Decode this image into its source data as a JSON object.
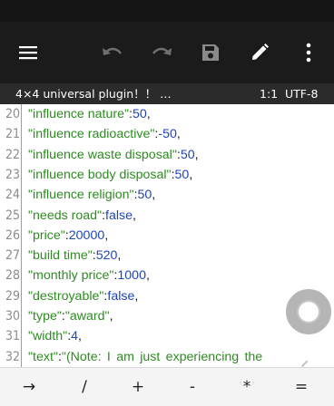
{
  "toolbar": {
    "menu_icon": "hamburger-menu-icon",
    "undo_icon": "undo-icon",
    "redo_icon": "redo-icon",
    "save_icon": "save-icon",
    "edit_icon": "pencil-icon",
    "overflow_icon": "more-vert-icon"
  },
  "file_bar": {
    "filename": "4×4 universal plugin！！ …",
    "cursor_position": "1:1",
    "encoding": "UTF-8"
  },
  "editor": {
    "lines": [
      {
        "num": "20",
        "key": "\"influence nature\"",
        "sep": ":",
        "val": "50",
        "end": ","
      },
      {
        "num": "21",
        "key": "\"influence radioactive\"",
        "sep": ":",
        "val": "-50",
        "end": ","
      },
      {
        "num": "22",
        "key": "\"influence waste disposal\"",
        "sep": ":",
        "val": "50",
        "end": ","
      },
      {
        "num": "23",
        "key": "\"influence body disposal\"",
        "sep": ":",
        "val": "50",
        "end": ","
      },
      {
        "num": "24",
        "key": "\"influence religion\"",
        "sep": ":",
        "val": "50",
        "end": ","
      },
      {
        "num": "25",
        "key": "\"needs road\"",
        "sep": ":",
        "val": "false",
        "end": ","
      },
      {
        "num": "26",
        "key": "\"price\"",
        "sep": ":",
        "val": "20000",
        "end": ","
      },
      {
        "num": "27",
        "key": "\"build time\"",
        "sep": ":",
        "val": "520",
        "end": ","
      },
      {
        "num": "28",
        "key": "\"monthly price\"",
        "sep": ":",
        "val": "1000",
        "end": ","
      },
      {
        "num": "29",
        "key": "\"destroyable\"",
        "sep": ":",
        "val": "false",
        "end": ","
      },
      {
        "num": "30",
        "key": "\"type\"",
        "sep": ":",
        "val": "\"award\"",
        "end": ","
      },
      {
        "num": "31",
        "key": "\"width\"",
        "sep": ":",
        "val": "4",
        "end": ","
      },
      {
        "num": "32",
        "key": "\"text\"",
        "sep": ":",
        "val": "\"(Note: I am just experiencing the",
        "end": ""
      }
    ]
  },
  "key_bar": {
    "keys": [
      "→",
      "/",
      "+",
      "-",
      "*",
      "="
    ]
  }
}
